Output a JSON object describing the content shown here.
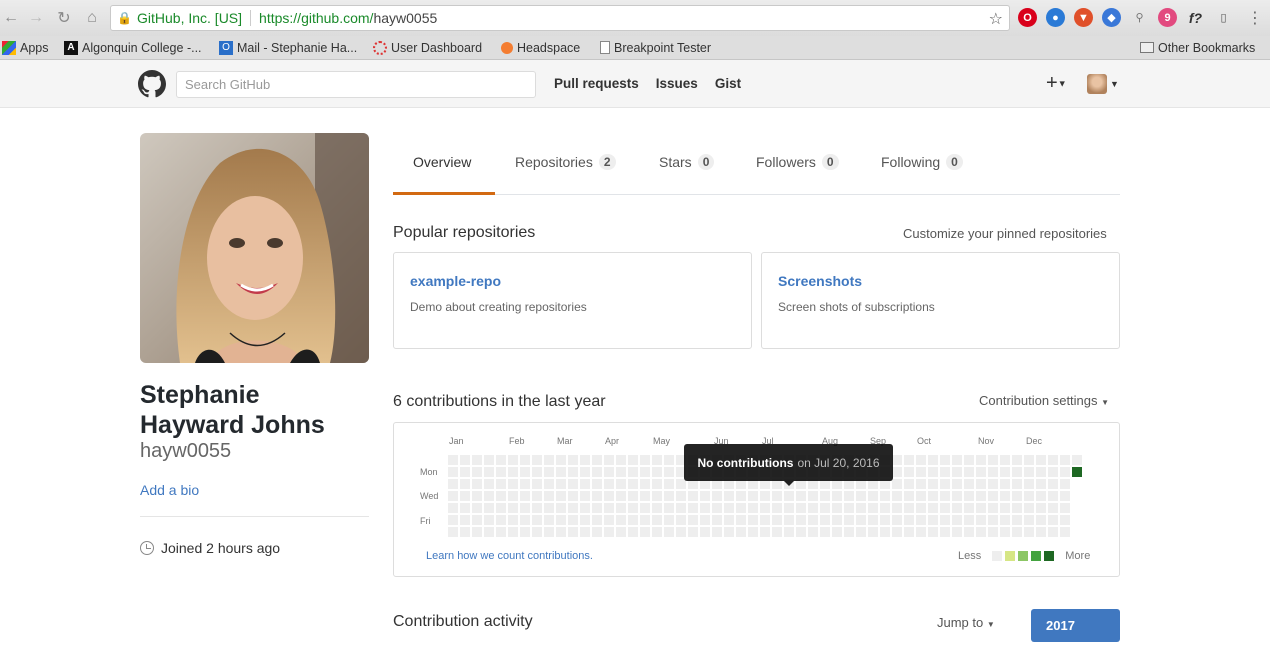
{
  "browser": {
    "secure_label": "GitHub, Inc. [US]",
    "url_host": "https://github.com/",
    "url_path": "hayw0055",
    "bookmarks": [
      "Apps",
      "Algonquin College -...",
      "Mail - Stephanie Ha...",
      "User Dashboard",
      "Headspace",
      "Breakpoint Tester"
    ],
    "other_bookmarks": "Other Bookmarks",
    "extension_badge": "9"
  },
  "header": {
    "search_placeholder": "Search GitHub",
    "nav": [
      "Pull requests",
      "Issues",
      "Gist"
    ],
    "plus_label": "+"
  },
  "profile": {
    "fullname": "Stephanie Hayward Johns",
    "username": "hayw0055",
    "add_bio": "Add a bio",
    "joined": "Joined 2 hours ago"
  },
  "tabs": [
    {
      "label": "Overview",
      "count": null
    },
    {
      "label": "Repositories",
      "count": "2"
    },
    {
      "label": "Stars",
      "count": "0"
    },
    {
      "label": "Followers",
      "count": "0"
    },
    {
      "label": "Following",
      "count": "0"
    }
  ],
  "popular": {
    "title": "Popular repositories",
    "customize": "Customize your pinned repositories",
    "repos": [
      {
        "name": "example-repo",
        "description": "Demo about creating repositories"
      },
      {
        "name": "Screenshots",
        "description": "Screen shots of subscriptions"
      }
    ]
  },
  "contributions": {
    "title": "6 contributions in the last year",
    "settings": "Contribution settings",
    "months": [
      "Jan",
      "Feb",
      "Mar",
      "Apr",
      "May",
      "Jun",
      "Jul",
      "Aug",
      "Sep",
      "Oct",
      "Nov",
      "Dec"
    ],
    "days": [
      "Mon",
      "Wed",
      "Fri"
    ],
    "learn_link": "Learn how we count contributions.",
    "legend_less": "Less",
    "legend_more": "More",
    "legend_colors": [
      "#eeeeee",
      "#d6e685",
      "#8cc665",
      "#44a340",
      "#1e6823"
    ],
    "tooltip_strong": "No contributions",
    "tooltip_rest": "on Jul 20, 2016",
    "active_day_color": "#1e6823"
  },
  "activity": {
    "title": "Contribution activity",
    "jump_to": "Jump to",
    "year": "2017"
  },
  "colors": {
    "link": "#4078c0",
    "tab_accent": "#d26911"
  }
}
